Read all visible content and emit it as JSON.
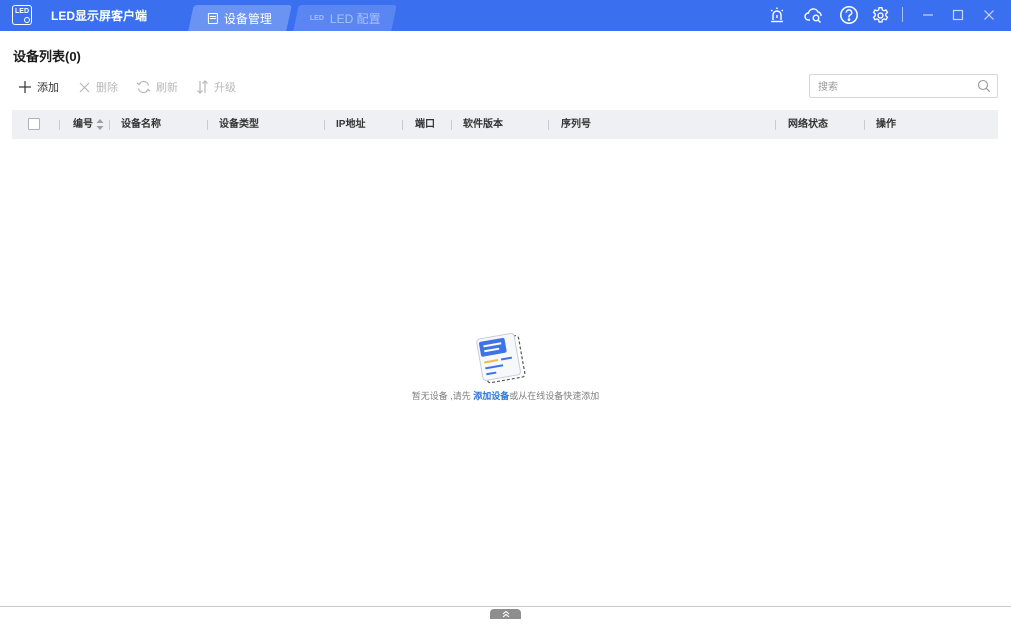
{
  "titlebar": {
    "logo_text": "LED",
    "app_title": "LED显示屏客户端",
    "tabs": [
      {
        "label": "设备管理",
        "active": true,
        "icon": "document-icon"
      },
      {
        "label": "LED 配置",
        "active": false,
        "icon": "led-icon"
      }
    ],
    "icons": [
      "alarm-icon",
      "cloud-search-icon",
      "help-icon",
      "gear-icon",
      "minimize-icon",
      "maximize-icon",
      "close-icon"
    ],
    "accent_color": "#3a6ff0"
  },
  "page": {
    "title": "设备列表(0)"
  },
  "toolbar": {
    "add_label": "添加",
    "delete_label": "删除",
    "refresh_label": "刷新",
    "upgrade_label": "升级",
    "search_placeholder": "搜索"
  },
  "table": {
    "columns": [
      "编号",
      "设备名称",
      "设备类型",
      "IP地址",
      "端口",
      "软件版本",
      "序列号",
      "网络状态",
      "操作"
    ],
    "rows": []
  },
  "empty_state": {
    "text_before": "暂无设备 ,请先 ",
    "link": "添加设备",
    "text_after": "或从在线设备快速添加",
    "link_color": "#2b74d8"
  }
}
